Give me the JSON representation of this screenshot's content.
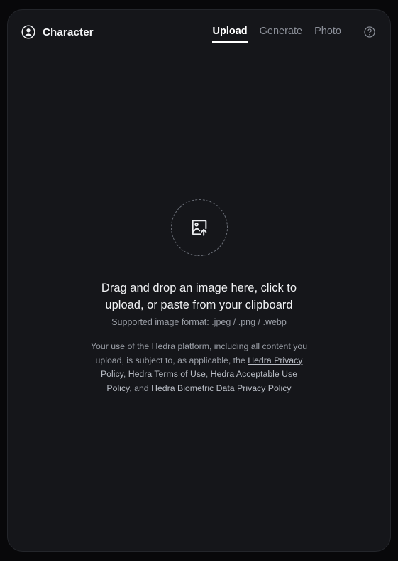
{
  "colors": {
    "page_background": "#08080a",
    "card_background": "#15161a",
    "card_border": "#24262b",
    "accent_text": "#ffffff",
    "muted_text": "#9a9ea6",
    "link_text": "#b9bdc5",
    "dashed_border": "#6c7079"
  },
  "header": {
    "avatar_icon": "account-circle-icon",
    "title": "Character",
    "tabs": [
      {
        "label": "Upload",
        "active": true
      },
      {
        "label": "Generate",
        "active": false
      },
      {
        "label": "Photo",
        "active": false
      }
    ],
    "help_icon": "help-circle-icon"
  },
  "dropzone": {
    "icon": "image-upload-icon",
    "headline": "Drag and drop an image here, click to upload, or paste from your clipboard",
    "formats": "Supported image format: .jpeg / .png / .webp",
    "legal": {
      "part1": "Your use of the Hedra platform, including all content you upload, is subject to, as applicable, the ",
      "link1": "Hedra Privacy Policy",
      "sep1": ", ",
      "link2": "Hedra Terms of Use",
      "sep2": ", ",
      "link3": "Hedra Acceptable Use Policy",
      "sep3": ", and ",
      "link4": "Hedra Biometric Data Privacy Policy"
    }
  }
}
